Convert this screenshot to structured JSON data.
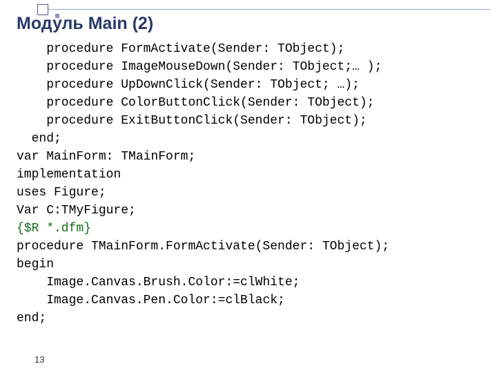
{
  "title": "Модуль Main (2)",
  "code": {
    "l1": "    procedure FormActivate(Sender: TObject);",
    "l2": "    procedure ImageMouseDown(Sender: TObject;… );",
    "l3": "    procedure UpDownClick(Sender: TObject; …);",
    "l4": "    procedure ColorButtonClick(Sender: TObject);",
    "l5": "    procedure ExitButtonClick(Sender: TObject);",
    "l6": "  end;",
    "l7": "var MainForm: TMainForm;",
    "l8": "implementation",
    "l9": "uses Figure;",
    "l10": "Var C:TMyFigure;",
    "l11": "{$R *.dfm}",
    "l12": "procedure TMainForm.FormActivate(Sender: TObject);",
    "l13": "begin",
    "l14": "    Image.Canvas.Brush.Color:=clWhite;",
    "l15": "    Image.Canvas.Pen.Color:=clBlack;",
    "l16": "end;"
  },
  "page_number": "13"
}
